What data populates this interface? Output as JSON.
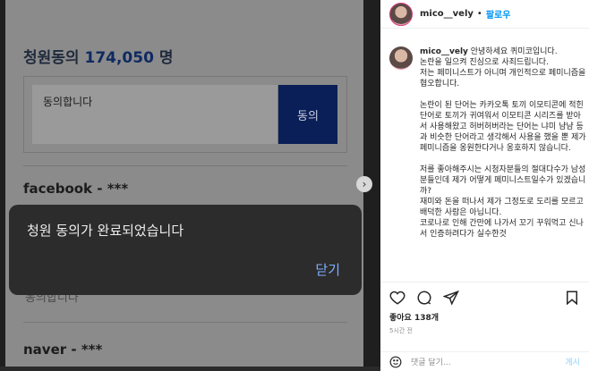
{
  "petition": {
    "label": "청원동의",
    "count": "174,050",
    "unit": "명",
    "input_text": "동의합니다",
    "agree_label": "동의",
    "comments": [
      {
        "author": "facebook - ***"
      },
      {
        "author": "naver - ***"
      }
    ],
    "faded_comment": "동의합니다"
  },
  "toast": {
    "message": "청원 동의가 완료되었습니다",
    "close_label": "닫기"
  },
  "instagram": {
    "username": "mico__vely",
    "separator": "•",
    "follow_label": "팔로우",
    "caption_user": "mico__vely",
    "caption_p1": " 안녕하세요 퀴미코입니다.\n논란을 일으켜 진심으로 사죄드립니다.\n저는 페미니스트가 아니며 개인적으로 페미니즘을 혐오합니다.",
    "caption_p2": "논란이 된 단어는 카카오톡 토끼 이모티콘에 적힌 단어로 토끼가 귀여워서 이모티콘 시리즈를 받아서 사용해왔고 허버허버라는 단어는 냐미 냠냠 등과 비슷한 단어라고 생각해서 사용을 했을 뿐 제가 페미니즘을 옹원한다거나 옹호하지 않습니다.",
    "caption_p3": "저를 좋아해주시는 시청자분들의 절대다수가 남성분들인데 제가 어떻게 페미니스트일수가 있겠습니까?\n재미와 돈을 떠나서 제가 그정도로 도리를 모르고 배덕한 사람은 아닙니다.\n코로나로 인해 간만에 나가서 꼬기 꾸워먹고 신나서 인증하려다가 실수한것",
    "likes": "좋아요 138개",
    "time": "5시간 전",
    "comment_placeholder": "댓글 달기...",
    "post_label": "게시",
    "icons": [
      "heart-icon",
      "comment-icon",
      "share-icon",
      "bookmark-icon",
      "smile-icon"
    ]
  }
}
